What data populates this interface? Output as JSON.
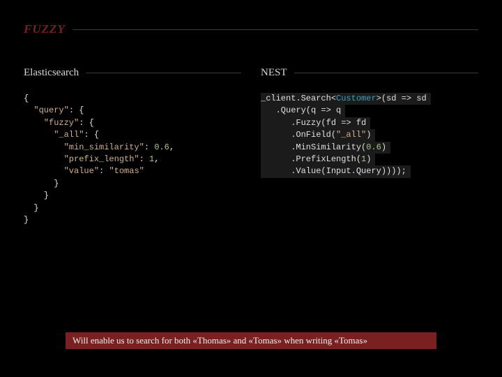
{
  "title": "FUZZY",
  "left": {
    "heading": "Elasticsearch",
    "code": {
      "l1": "{",
      "l2a": "  \"query\"",
      "l2b": ": {",
      "l3a": "    \"fuzzy\"",
      "l3b": ": {",
      "l4a": "      \"_all\"",
      "l4b": ": {",
      "l5a": "        \"min_similarity\"",
      "l5b": ": ",
      "l5c": "0.6",
      "l5d": ",",
      "l6a": "        \"prefix_length\"",
      "l6b": ": ",
      "l6c": "1",
      "l6d": ",",
      "l7a": "        \"value\"",
      "l7b": ": ",
      "l7c": "\"tomas\"",
      "l8": "      }",
      "l9": "    }",
      "l10": "  }",
      "l11": "}"
    }
  },
  "right": {
    "heading": "NEST",
    "code": {
      "l1a": "_client.Search<",
      "l1b": "Customer",
      "l1c": ">(sd => sd",
      "l2": "   .Query(q => q",
      "l3": "      .Fuzzy(fd => fd",
      "l4a": "      .OnField(",
      "l4b": "\"_all\"",
      "l4c": ")",
      "l5a": "      .MinSimilarity(",
      "l5b": "0.6",
      "l5c": ")",
      "l6a": "      .PrefixLength(",
      "l6b": "1",
      "l6c": ")",
      "l7": "      .Value(Input.Query))));"
    }
  },
  "footnote": "Will enable us to search for both «Thomas» and «Tomas» when writing «Tomas»"
}
